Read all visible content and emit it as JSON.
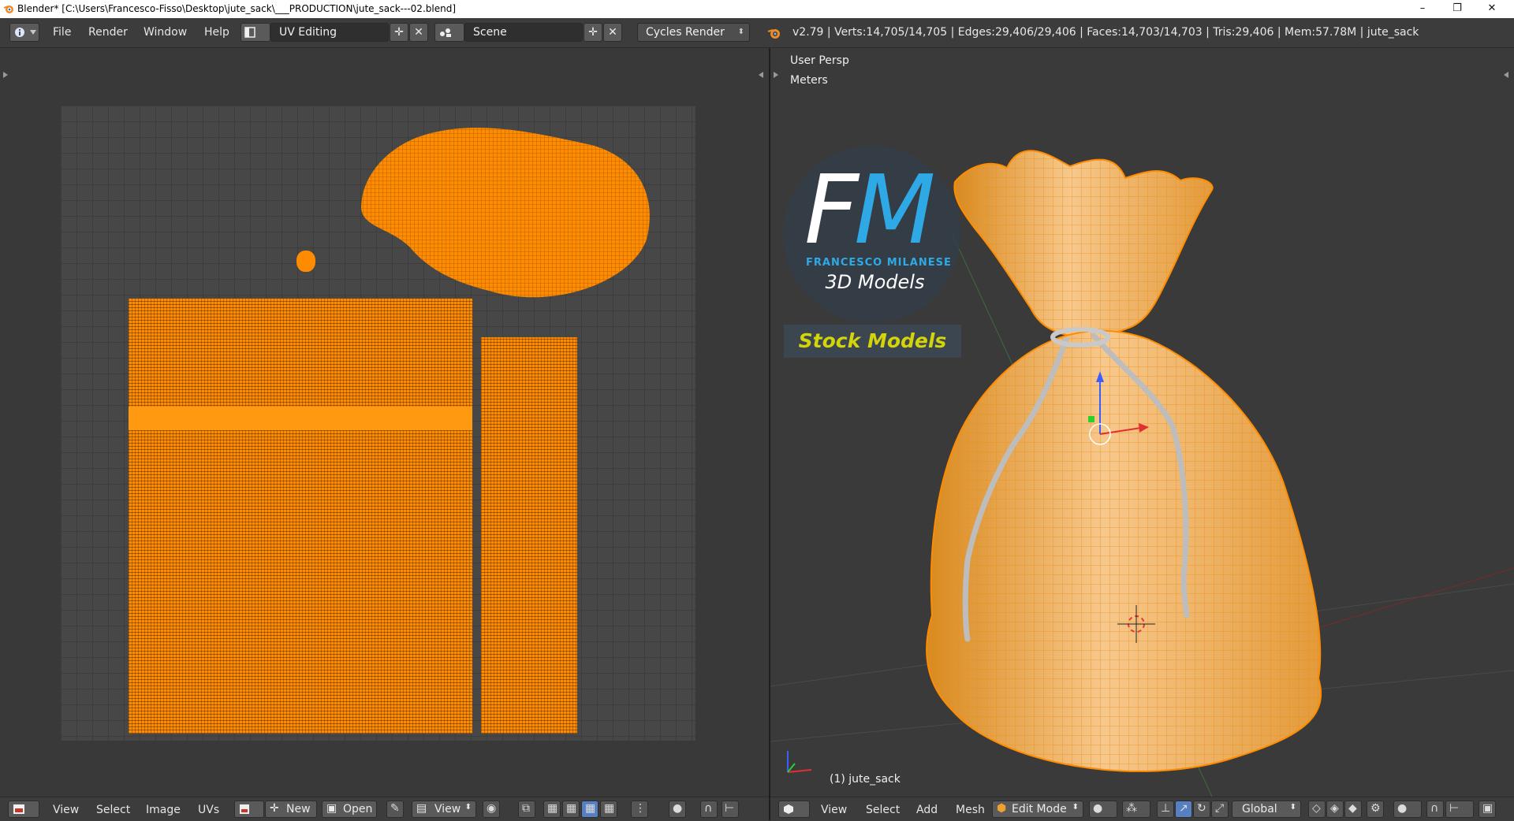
{
  "window": {
    "title": "Blender* [C:\\Users\\Francesco-Fisso\\Desktop\\jute_sack\\___PRODUCTION\\jute_sack---02.blend]",
    "minimize": "–",
    "restore": "❐",
    "close": "✕"
  },
  "info_header": {
    "menus": [
      "File",
      "Render",
      "Window",
      "Help"
    ],
    "screen_layout": "UV Editing",
    "scene": "Scene",
    "render_engine": "Cycles Render",
    "stats": "v2.79 | Verts:14,705/14,705 | Edges:29,406/29,406 | Faces:14,703/14,703 | Tris:29,406 | Mem:57.78M | jute_sack"
  },
  "uv_editor": {
    "menus": [
      "View",
      "Select",
      "Image",
      "UVs"
    ],
    "new_label": "New",
    "open_label": "Open",
    "view_label": "View"
  },
  "viewport": {
    "persp_label": "User Persp",
    "units_label": "Meters",
    "object_label": "(1) jute_sack",
    "menus": [
      "View",
      "Select",
      "Add",
      "Mesh"
    ],
    "mode": "Edit Mode",
    "orientation": "Global"
  },
  "logo": {
    "fm_f": "F",
    "fm_m": "M",
    "name": "FRANCESCO MILANESE",
    "subtitle": "3D Models",
    "stock": "Stock Models"
  },
  "colors": {
    "selection": "#ff8c00",
    "accent_blue": "#2fa9e6",
    "stock_yellow": "#d4d40a",
    "active_button": "#5680c2"
  },
  "icons": [
    "blender-icon",
    "info-icon",
    "layout-icon",
    "scene-icon",
    "render-icon",
    "image-editor-icon",
    "pin-icon",
    "view3d-icon",
    "mesh-icon",
    "viewport-shading-icon",
    "pivot-icon",
    "manipulator-icon"
  ]
}
